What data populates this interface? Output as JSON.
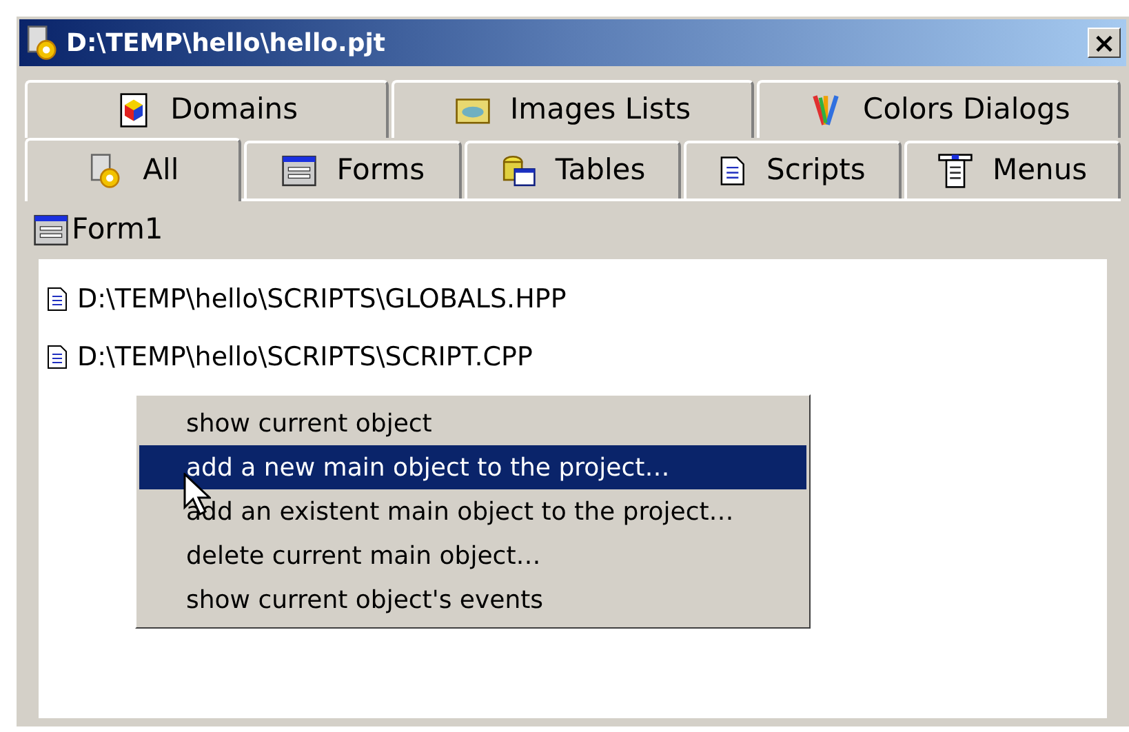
{
  "window": {
    "title": "D:\\TEMP\\hello\\hello.pjt",
    "close": "×"
  },
  "tab_rows": [
    [
      {
        "label": "Domains",
        "kind": "domain",
        "selected": false
      },
      {
        "label": "Images Lists",
        "kind": "images",
        "selected": false
      },
      {
        "label": "Colors Dialogs",
        "kind": "colors",
        "selected": false
      }
    ],
    [
      {
        "label": "All",
        "kind": "all",
        "selected": true
      },
      {
        "label": "Forms",
        "kind": "form",
        "selected": false
      },
      {
        "label": "Tables",
        "kind": "table",
        "selected": false
      },
      {
        "label": "Scripts",
        "kind": "script",
        "selected": false
      },
      {
        "label": "Menus",
        "kind": "menu",
        "selected": false
      }
    ]
  ],
  "header_item": {
    "label": "Form1",
    "kind": "form"
  },
  "items": [
    {
      "label": "D:\\TEMP\\hello\\SCRIPTS\\GLOBALS.HPP",
      "kind": "script"
    },
    {
      "label": "D:\\TEMP\\hello\\SCRIPTS\\SCRIPT.CPP",
      "kind": "script"
    }
  ],
  "context_menu": [
    {
      "label": "show current object",
      "selected": false
    },
    {
      "label": "add a new main object to the project…",
      "selected": true
    },
    {
      "label": "add an existent main object to the project…",
      "selected": false
    },
    {
      "label": "delete current main object…",
      "selected": false
    },
    {
      "label": "show current object's events",
      "selected": false
    }
  ]
}
